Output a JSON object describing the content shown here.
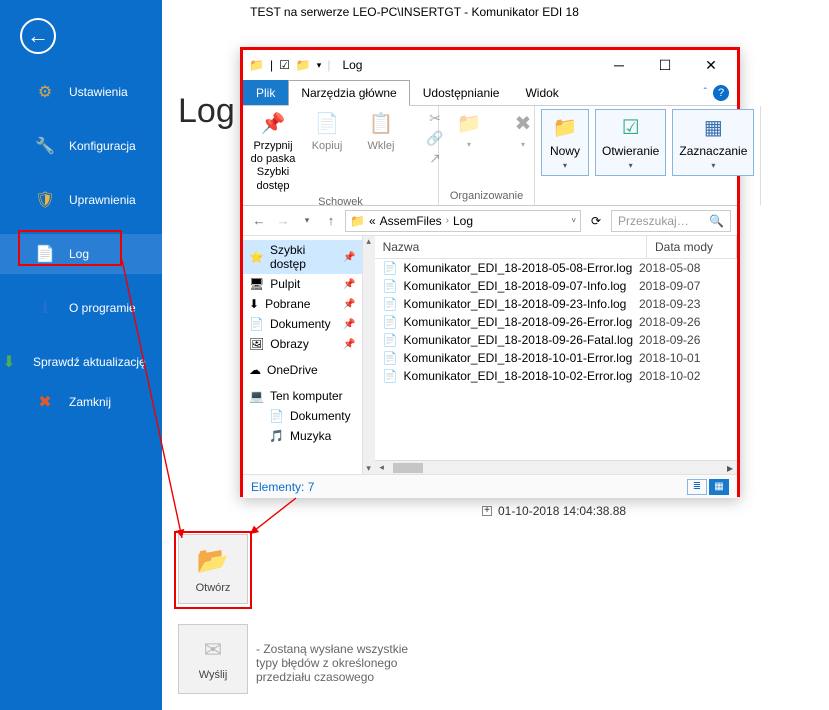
{
  "title": "TEST na serwerze LEO-PC\\INSERTGT - Komunikator EDI 18",
  "sidebar": {
    "items": [
      {
        "label": "Ustawienia",
        "icon": "⚙"
      },
      {
        "label": "Konfiguracja",
        "icon": "🔧"
      },
      {
        "label": "Uprawnienia",
        "icon": "🛡"
      },
      {
        "label": "Log",
        "icon": "📄"
      },
      {
        "label": "O programie",
        "icon": "ℹ"
      },
      {
        "label": "Sprawdź aktualizację",
        "icon": "⬇"
      },
      {
        "label": "Zamknij",
        "icon": "✖"
      }
    ]
  },
  "page": {
    "title": "Log",
    "open_card": "Otwórz",
    "send_card": "Wyślij",
    "send_desc": "- Zostaną wysłane wszystkie typy błędów z określonego przedziału czasowego",
    "timestamp": "01-10-2018 14:04:38.88"
  },
  "explorer": {
    "window_title": "Log",
    "tabs": {
      "file": "Plik",
      "home": "Narzędzia główne",
      "share": "Udostępnianie",
      "view": "Widok"
    },
    "ribbon": {
      "pin": "Przypnij do paska Szybki dostęp",
      "copy": "Kopiuj",
      "paste": "Wklej",
      "clipboard_cap": "Schowek",
      "organize_cap": "Organizowanie",
      "new": "Nowy",
      "open": "Otwieranie",
      "select": "Zaznaczanie"
    },
    "path": {
      "root": "AssemFiles",
      "leaf": "Log"
    },
    "search_placeholder": "Przeszukaj…",
    "columns": {
      "name": "Nazwa",
      "date": "Data mody"
    },
    "tree": {
      "quick": "Szybki dostęp",
      "desktop": "Pulpit",
      "downloads": "Pobrane",
      "documents": "Dokumenty",
      "pictures": "Obrazy",
      "onedrive": "OneDrive",
      "thispc": "Ten komputer",
      "docs2": "Dokumenty",
      "music": "Muzyka"
    },
    "files": [
      {
        "name": "Komunikator_EDI_18-2018-05-08-Error.log",
        "date": "2018-05-08"
      },
      {
        "name": "Komunikator_EDI_18-2018-09-07-Info.log",
        "date": "2018-09-07"
      },
      {
        "name": "Komunikator_EDI_18-2018-09-23-Info.log",
        "date": "2018-09-23"
      },
      {
        "name": "Komunikator_EDI_18-2018-09-26-Error.log",
        "date": "2018-09-26"
      },
      {
        "name": "Komunikator_EDI_18-2018-09-26-Fatal.log",
        "date": "2018-09-26"
      },
      {
        "name": "Komunikator_EDI_18-2018-10-01-Error.log",
        "date": "2018-10-01"
      },
      {
        "name": "Komunikator_EDI_18-2018-10-02-Error.log",
        "date": "2018-10-02"
      }
    ],
    "status": "Elementy: 7"
  }
}
